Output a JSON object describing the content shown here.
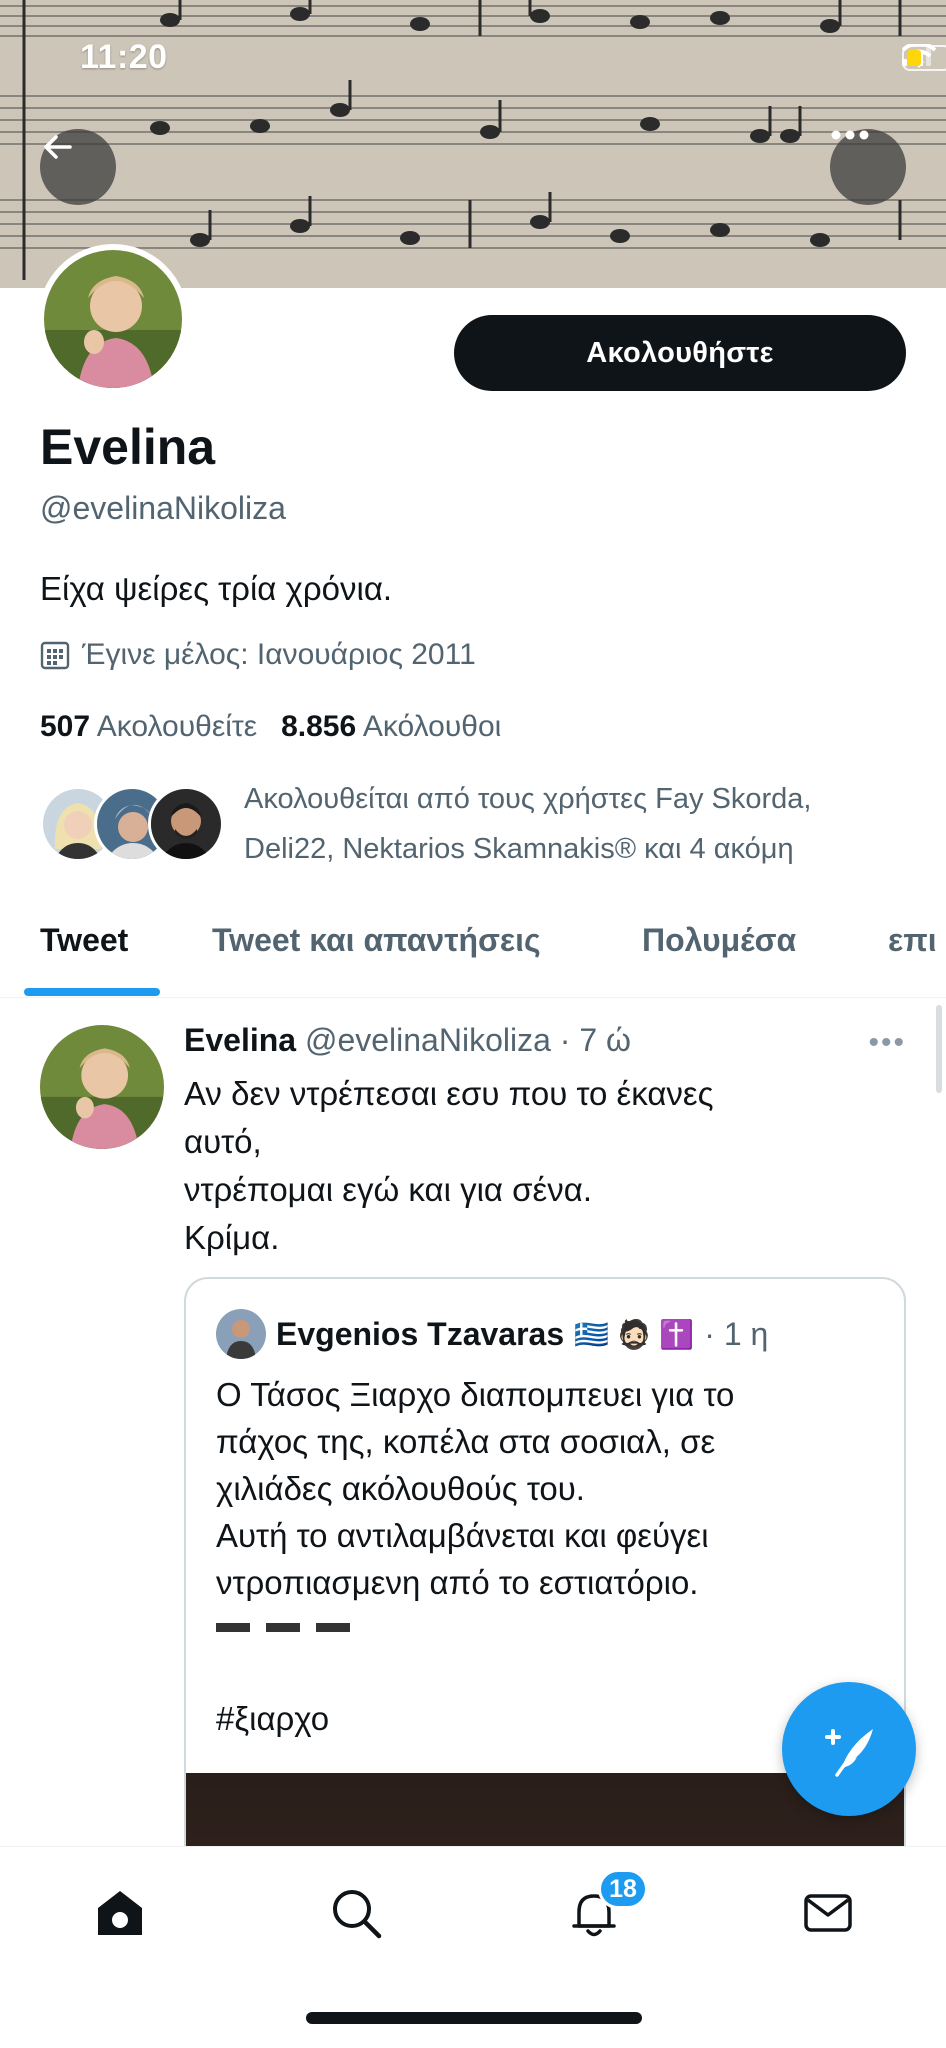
{
  "status_bar": {
    "time": "11:20"
  },
  "profile": {
    "follow_label": "Ακολουθήστε",
    "name": "Evelina",
    "handle": "@evelinaNikoliza",
    "bio": "Είχα ψείρες τρία χρόνια.",
    "joined": "Έγινε μέλος: Ιανουάριος 2011",
    "following_count": "507",
    "following_label": "Ακολουθείτε",
    "followers_count": "8.856",
    "followers_label": "Ακόλουθοι",
    "followed_by_line1": "Ακολουθείται από τους χρήστες Fay Skorda,",
    "followed_by_line2": "Deli22, Nektarios Skamnakis® και 4 ακόμη"
  },
  "tabs": [
    {
      "label": "Tweet",
      "active": true
    },
    {
      "label": "Tweet και απαντήσεις",
      "active": false
    },
    {
      "label": "Πολυμέσα",
      "active": false
    },
    {
      "label": "επι",
      "active": false
    }
  ],
  "tweet": {
    "name": "Evelina",
    "meta": "@evelinaNikoliza · 7 ώ",
    "more": "•••",
    "lines": [
      "Αν δεν ντρέπεσαι εσυ που το έκανες",
      "αυτό,",
      "ντρέπομαι εγώ και για σένα.",
      "Κρίμα."
    ]
  },
  "quote": {
    "name": "Evgenios Tzavaras",
    "emoji": "🇬🇷 🧔🏻 ✝️",
    "time": "· 1 η",
    "lines": [
      "Ο Τάσος Ξιαρχο διαπομπευει για το",
      "πάχος της, κοπέλα στα σοσιαλ, σε",
      "χιλιάδες ακόλουθούς του.",
      "Αυτή το αντιλαμβάνεται και φεύγει",
      "ντροπιασμενη από το εστιατόριο."
    ],
    "hashtag": "#ξιαρχο"
  },
  "bottom_nav": {
    "items": [
      "home-icon",
      "search-icon",
      "bell-icon",
      "mail-icon"
    ],
    "notification_badge": "18"
  },
  "colors": {
    "accent": "#1d9bf0",
    "text": "#0f1419",
    "secondary": "#536471"
  }
}
